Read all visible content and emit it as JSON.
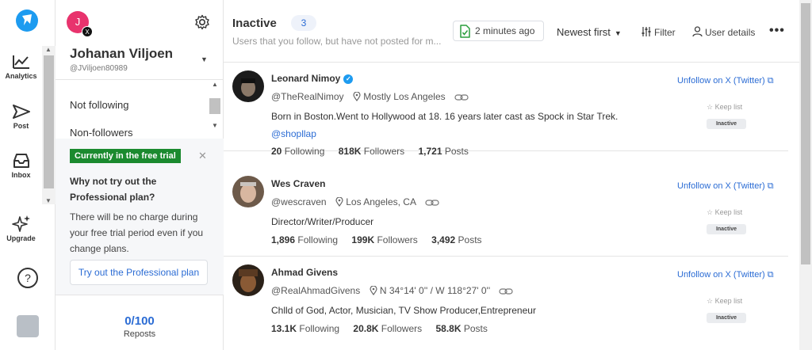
{
  "rail": {
    "items": [
      {
        "label": "Analytics",
        "icon": "chart-line-icon"
      },
      {
        "label": "Post",
        "icon": "send-icon"
      },
      {
        "label": "Inbox",
        "icon": "inbox-icon"
      },
      {
        "label": "Upgrade",
        "icon": "sparkles-icon"
      }
    ],
    "colors": {
      "brand": "#1d9bf0"
    }
  },
  "account": {
    "avatar_letter": "J",
    "avatar_color": "#e8336d",
    "network_badge": "X",
    "name": "Johanan Viljoen",
    "handle": "@JViljoen80989",
    "menu": [
      "Not following",
      "Non-followers"
    ]
  },
  "trial": {
    "badge": "Currently in the free trial",
    "title": "Why not try out the Professional plan?",
    "text": "There will be no charge during your free trial period even if you change plans.",
    "button": "Try out the Professional plan"
  },
  "reposts": {
    "count": "0/100",
    "label": "Reposts"
  },
  "header": {
    "title": "Inactive",
    "count": "3",
    "subtitle": "Users that you follow, but have not posted for m...",
    "updated": "2 minutes ago",
    "sort": "Newest first",
    "filter": "Filter",
    "user_details": "User details",
    "more": "•••"
  },
  "users": [
    {
      "name": "Leonard Nimoy",
      "verified": true,
      "handle": "@TheRealNimoy",
      "location": "Mostly Los Angeles",
      "bio": "Born in Boston.Went to Hollywood at 18. 16 years later cast as Spock in Star Trek.",
      "link": "@shopllap",
      "following": "20",
      "followers": "818K",
      "posts": "1,721",
      "following_label": "Following",
      "followers_label": "Followers",
      "posts_label": "Posts",
      "unfollow": "Unfollow on X (Twitter)",
      "keep": "Keep list",
      "status": "Inactive"
    },
    {
      "name": "Wes Craven",
      "verified": false,
      "handle": "@wescraven",
      "location": "Los Angeles, CA",
      "bio": "Director/Writer/Producer",
      "link": "",
      "following": "1,896",
      "followers": "199K",
      "posts": "3,492",
      "following_label": "Following",
      "followers_label": "Followers",
      "posts_label": "Posts",
      "unfollow": "Unfollow on X (Twitter)",
      "keep": "Keep list",
      "status": "Inactive"
    },
    {
      "name": "Ahmad Givens",
      "verified": false,
      "handle": "@RealAhmadGivens",
      "location": "N 34°14' 0'' / W 118°27' 0''",
      "bio": "Chlld of God, Actor, Musician, TV Show Producer,Entrepreneur",
      "link": "",
      "following": "13.1K",
      "followers": "20.8K",
      "posts": "58.8K",
      "following_label": "Following",
      "followers_label": "Followers",
      "posts_label": "Posts",
      "unfollow": "Unfollow on X (Twitter)",
      "keep": "Keep list",
      "status": "Inactive"
    }
  ]
}
